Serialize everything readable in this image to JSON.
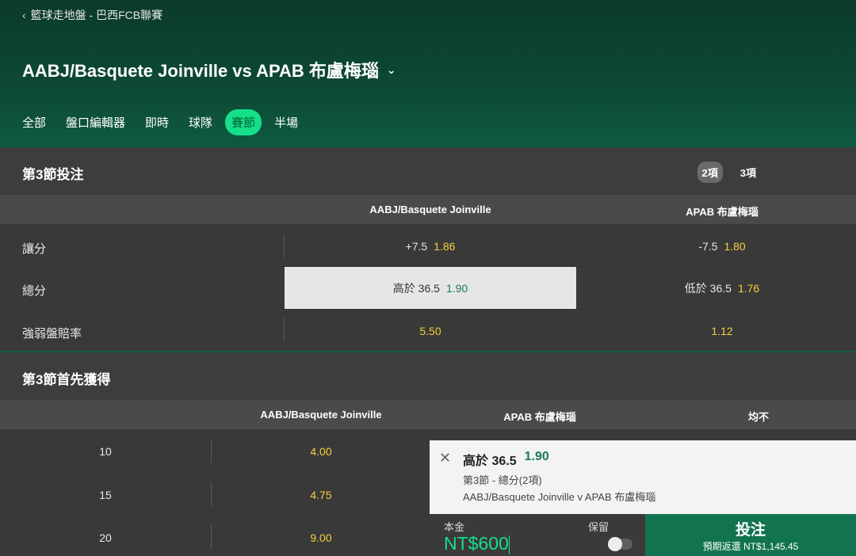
{
  "breadcrumb": {
    "text": "籃球走地盤 - 巴西FCB聯賽"
  },
  "header": {
    "title": "AABJ/Basquete Joinville vs APAB 布盧梅瑙"
  },
  "tabs": [
    {
      "label": "全部"
    },
    {
      "label": "盤口編輯器"
    },
    {
      "label": "即時"
    },
    {
      "label": "球隊"
    },
    {
      "label": "賽節"
    },
    {
      "label": "半場"
    }
  ],
  "section1": {
    "title": "第3節投注",
    "pills": [
      "2項",
      "3項"
    ],
    "col_home": "AABJ/Basquete Joinville",
    "col_away": "APAB 布盧梅瑙",
    "rows": [
      {
        "label": "讓分",
        "home_line": "+7.5",
        "home_odds": "1.86",
        "away_line": "-7.5",
        "away_odds": "1.80"
      },
      {
        "label": "總分",
        "home_line": "高於 36.5",
        "home_odds": "1.90",
        "away_line": "低於 36.5",
        "away_odds": "1.76"
      },
      {
        "label": "強弱盤賠率",
        "home_line": "",
        "home_odds": "5.50",
        "away_line": "",
        "away_odds": "1.12"
      }
    ]
  },
  "section2": {
    "title": "第3節首先獲得",
    "col_home": "AABJ/Basquete Joinville",
    "col_away": "APAB 布盧梅瑙",
    "col_none": "均不",
    "rows": [
      {
        "points": "10",
        "home_odds": "4.00"
      },
      {
        "points": "15",
        "home_odds": "4.75"
      },
      {
        "points": "20",
        "home_odds": "9.00"
      }
    ]
  },
  "slip": {
    "selection": "高於 36.5",
    "odds": "1.90",
    "market": "第3節 - 總分(2項)",
    "event": "AABJ/Basquete Joinville v APAB 布盧梅瑙",
    "stake_label": "本金",
    "stake_value": "NT$600",
    "keep_label": "保留",
    "bet_label": "投注",
    "return_text": "預期返還 NT$1,145.45"
  },
  "colors": {
    "accent": "#14e08a",
    "odds": "#f6cf3b",
    "header": "#0d4a35",
    "bet_button": "#12744f"
  }
}
